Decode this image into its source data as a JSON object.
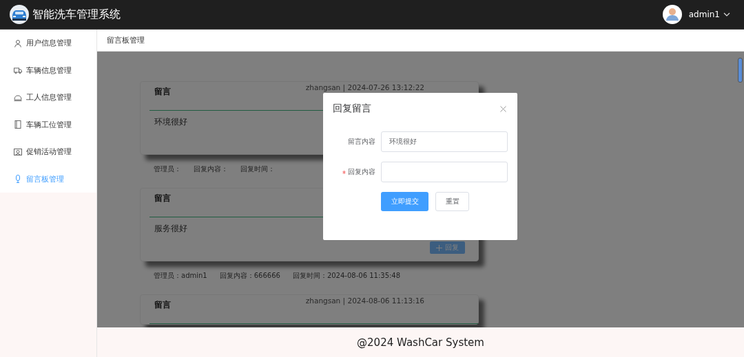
{
  "header": {
    "title": "智能洗车管理系统",
    "user": "admin1"
  },
  "sidebar": {
    "items": [
      {
        "label": "用户信息管理",
        "selected": false
      },
      {
        "label": "车辆信息管理",
        "selected": false
      },
      {
        "label": "工人信息管理",
        "selected": false
      },
      {
        "label": "车辆工位管理",
        "selected": false
      },
      {
        "label": "促销活动管理",
        "selected": false
      },
      {
        "label": "留言板管理",
        "selected": true
      }
    ]
  },
  "breadcrumb": "留言板管理",
  "messages": [
    {
      "title": "留言",
      "meta": "zhangsan | 2024-07-26 13:12:22",
      "content": "环境很好",
      "reply": [
        "管理员：",
        "回复内容：",
        "回复时间："
      ]
    },
    {
      "title": "留言",
      "content": "服务很好",
      "reply_button": "回复",
      "reply": [
        "管理员：admin1",
        "回复内容：666666",
        "回复时间：2024-08-06 11:35:48"
      ]
    },
    {
      "title": "留言",
      "meta": "zhangsan | 2024-08-06 11:13:16"
    }
  ],
  "dialog": {
    "title": "回复留言",
    "fields": [
      {
        "label": "留言内容",
        "value": "环境很好",
        "required": false
      },
      {
        "label": "回复内容",
        "required": true
      }
    ],
    "buttons": [
      {
        "label": "立即提交",
        "kind": "primary"
      },
      {
        "label": "重置",
        "kind": "plain"
      }
    ]
  },
  "footer": "@2024 WashCar System"
}
